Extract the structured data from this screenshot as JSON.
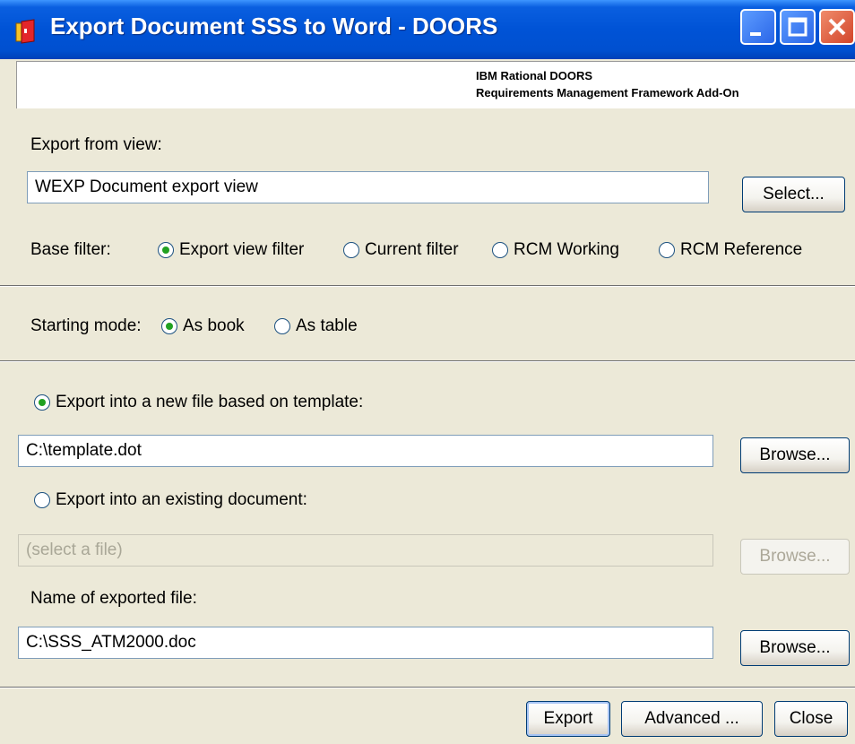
{
  "window": {
    "title": "Export Document SSS to Word - DOORS"
  },
  "banner": {
    "line1": "IBM Rational DOORS",
    "line2": "Requirements Management Framework Add-On"
  },
  "view": {
    "label": "Export from view:",
    "value": "WEXP Document export view",
    "select_label": "Select..."
  },
  "base_filter": {
    "label": "Base filter:",
    "options": [
      {
        "label": "Export view filter",
        "checked": true
      },
      {
        "label": "Current filter",
        "checked": false
      },
      {
        "label": "RCM Working",
        "checked": false
      },
      {
        "label": "RCM Reference",
        "checked": false
      }
    ]
  },
  "starting_mode": {
    "label": "Starting mode:",
    "options": [
      {
        "label": "As book",
        "checked": true
      },
      {
        "label": "As table",
        "checked": false
      }
    ]
  },
  "template": {
    "radio_label": "Export into a new file based on template:",
    "value": "C:\\template.dot",
    "browse_label": "Browse..."
  },
  "existing": {
    "radio_label": "Export into an existing document:",
    "placeholder": "(select a file)",
    "browse_label": "Browse..."
  },
  "output": {
    "label": "Name of exported file:",
    "value": "C:\\SSS_ATM2000.doc",
    "browse_label": "Browse..."
  },
  "footer": {
    "export_label": "Export",
    "advanced_label": "Advanced ...",
    "close_label": "Close"
  }
}
